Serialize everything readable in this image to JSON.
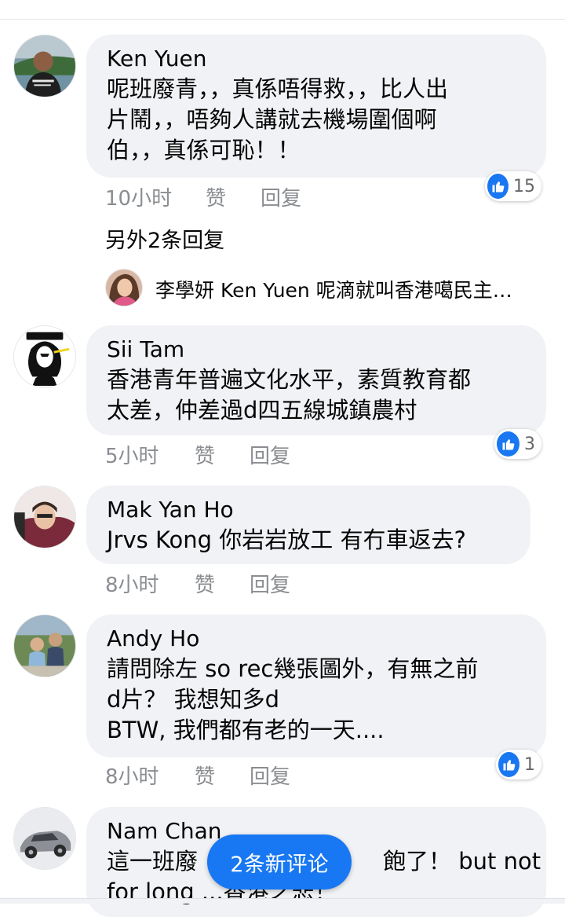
{
  "comments": [
    {
      "author": "Ken Yuen",
      "text": "呢班廢青，，真係唔得救，，比人出\n片鬧，，唔夠人講就去機場圍個啊\n伯，，真係可恥！！",
      "time": "10小时",
      "like_label": "赞",
      "reply_label": "回复",
      "reactions": "15"
    },
    {
      "author": "Sii Tam",
      "text": "香港青年普遍文化水平，素質教育都\n太差，仲差過d四五線城鎮農村",
      "time": "5小时",
      "like_label": "赞",
      "reply_label": "回复",
      "reactions": "3"
    },
    {
      "author": "Mak Yan Ho",
      "text": "Jrvs Kong 你岩岩放工 有冇車返去?",
      "time": "8小时",
      "like_label": "赞",
      "reply_label": "回复"
    },
    {
      "author": "Andy Ho",
      "text": "請問除左 so rec幾張圖外，有無之前\nd片？ 我想知多d\nBTW, 我們都有老的一天....",
      "time": "8小时",
      "like_label": "赞",
      "reply_label": "回复",
      "reactions": "1"
    },
    {
      "author": "Nam Chan",
      "text_line1_left": "這一班廢",
      "text_line1_right": "飽了！ but not",
      "text_line2": "for long ...香港之悲！"
    }
  ],
  "thread": {
    "more_replies": "另外2条回复",
    "reply_author": "李學妍",
    "reply_text": "Ken Yuen 呢滴就叫香港噶民主…"
  },
  "new_comments_button": "2条新评论",
  "colors": {
    "bubble": "#f0f2f5",
    "accent": "#1877f2",
    "meta": "#8a8d91"
  }
}
